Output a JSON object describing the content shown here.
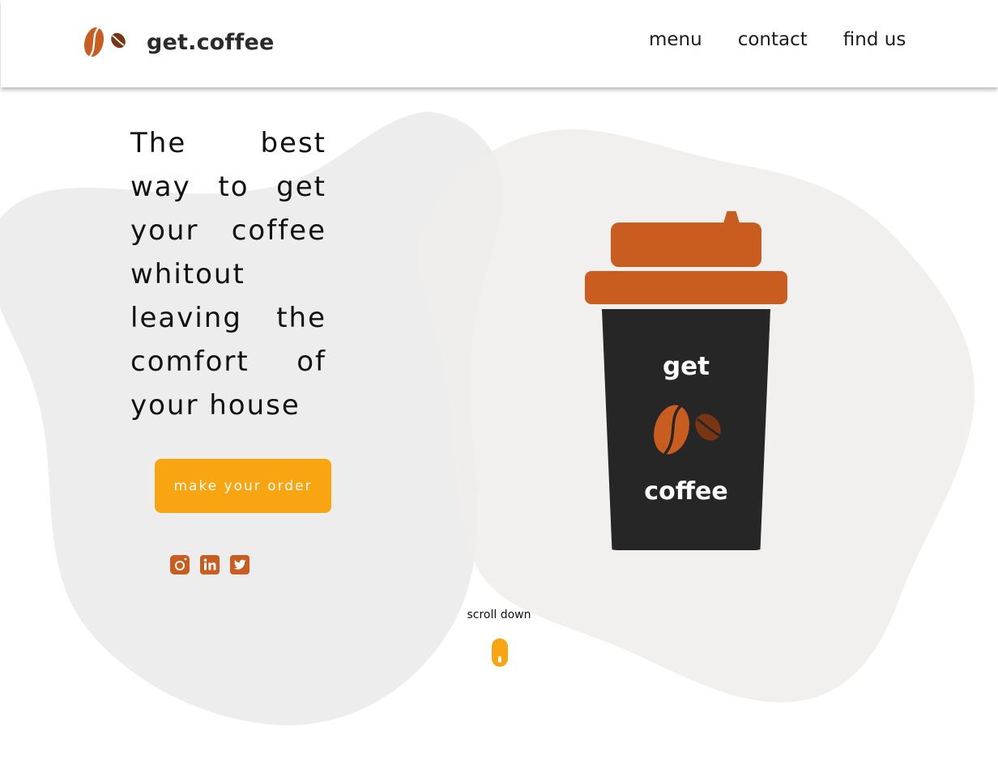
{
  "brand": {
    "name": "get.coffee",
    "logo_icon": "coffee-beans-icon"
  },
  "nav": {
    "items": [
      {
        "label": "menu"
      },
      {
        "label": "contact"
      },
      {
        "label": "find us"
      }
    ]
  },
  "hero": {
    "headline": "The best way to get your coffee whitout leaving the comfort of your house",
    "cta_label": "make your order",
    "socials": [
      {
        "name": "instagram",
        "icon": "instagram-icon"
      },
      {
        "name": "linkedin",
        "icon": "linkedin-icon"
      },
      {
        "name": "twitter",
        "icon": "twitter-icon"
      }
    ]
  },
  "cup": {
    "label_top": "get",
    "label_bottom": "coffee",
    "icon": "coffee-beans-icon"
  },
  "scroll": {
    "label": "scroll down",
    "icon": "mouse-scroll-icon"
  },
  "colors": {
    "accent": "#f9a411",
    "brand_orange": "#c95c1f",
    "bean_dark": "#7a3512",
    "cup_dark": "#262626",
    "blob_left": "#ececec",
    "blob_right": "#f1f0ef",
    "text": "#111111"
  }
}
